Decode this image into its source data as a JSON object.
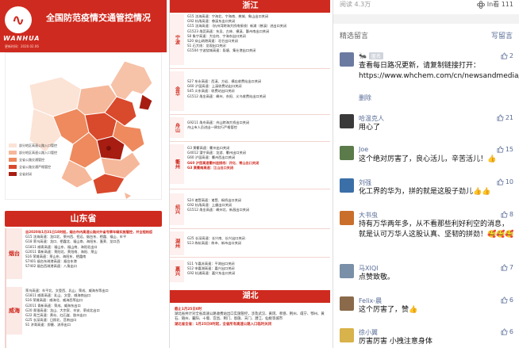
{
  "panel1": {
    "brand": "WANHUA",
    "title": "全国防范疫情交通管控情况",
    "date": "更新时间：2020.02.06",
    "legend": [
      {
        "label": "部分地区高速公路入口管控",
        "color": "#fbe3d6"
      },
      {
        "label": "部分地区高速公路入口管控",
        "color": "#f6b89a"
      },
      {
        "label": "全省公路交通管控",
        "color": "#ee8a5e"
      },
      {
        "label": "全省公路交通严格管控",
        "color": "#d9492c"
      },
      {
        "label": "全省封闭",
        "color": "#a71d12"
      }
    ],
    "province": "山东省",
    "city_yantai": "烟台",
    "city_weihai": "威海",
    "lines_a": [
      "自2020年1月31日18时起，烟台市内高速公路对外省号牌车辆实施管控，并全程检疫",
      "G15 沈海高速：龙口北、莱州西、招远、烟台东、栖霞、福山、牟平",
      "G18 荣乌高速：龙口、栖霞北、福山南、海阳东、蓬莱、龙口西",
      "G1811 威青高速：福山东、福山南、海阳北出口",
      "G2011 青新高速：莱阳北、莱阳南、海阳、莱山",
      "S16 荣潍高速：莱山东、海阳东、栖霞南",
      "S7401 烟台东疏港高速：烟台东港",
      "S7402 烟台西疏港高速：八角出口"
    ],
    "lines_b": [
      "荣乌高速：牟平北、文登西、乳山、荣成、威海东等出口",
      "G1811 威青高速：乳山、文登、威海南出口",
      "S16 荣潍高速：威海北、威海西等出口",
      "G2011 青新高速：荣成、威海东出口",
      "G20 青银高速：龙山、大宗家、辛安、荣成北出口",
      "G22 青兰高速：黄岛、红石崖、胶州出口",
      "G25 长深高速：日照北、莒南出口",
      "S1 济青高速：即墨、流亭出口"
    ]
  },
  "panel2": {
    "zhejiang": "浙江",
    "hubei": "湖北",
    "cities": [
      "宁波",
      "金华",
      "舟山",
      "衢州",
      "绍兴",
      "湖州",
      "嘉兴"
    ],
    "lines_ningbo": [
      "G15 沈海高速：宁海北、宁海南、慈城、象山出口关闭",
      "G92 杭甬高速：慈溪东出口关闭",
      "G15 沈海高速：（杭州湾跨海大桥南接线）新浦（慈溪）进出口关闭",
      "G1523 甬莞高速：东吴、古林、横溪、鄞州南出口关闭",
      "S0 象宁高速：大佳何、宁海东出口关闭",
      "S20 穿山疏港高速：北仑出口关闭",
      "S1 石大线：龙观出口关闭",
      "G1504 宁波绕城高速：段塘、集仕港出口关闭"
    ],
    "lines_jinhua": [
      "S27 东永高速：西溪、方岩、横店收费站出口关闭",
      "G60 沪昆高速：上溪收费站出口关闭",
      "S45 义东高速：收费站出口关闭",
      "G1512 甬金高速：嵊州、东阳、义乌收费站出口关闭"
    ],
    "lines_zhoushan": [
      "G9211 甬舟高速：舟山跨海大桥出口关闭",
      "舟山市人员进出一律实行严格管控"
    ],
    "lines_quzhou": [
      "G3 黄衢高速：衢州出口关闭",
      "G4012 溧宁高速：龙游、衢州出口关闭",
      "G60 沪昆高速：衢州西出口关闭",
      "G60 沪昆高速衢州连接线：开化、常山出口关闭",
      "G3 黄衢南高速：江山出口关闭"
    ],
    "lines_shaoxing": [
      "S24 诸暨高速：诸暨、枫桥出口关闭",
      "G92 杭甬高速：上虞出口关闭",
      "G1512 甬金高速：嵊州北、新昌出口关闭"
    ],
    "lines_huzhou": [
      "G25 长深高速：长兴南、长兴出口关闭",
      "S13 练杭高速：练市、新市出口关闭"
    ],
    "lines_jiaxing": [
      "S11 乍嘉苏高速：平湖出口关闭",
      "S12 申嘉湖高速：嘉兴出口关闭",
      "G92 杭浦高速：嘉兴东出口关闭"
    ],
    "hubei_lines": [
      "截止1月25日0时",
      "湖北省共计对全省高速公路收费站出口实施管控，涉及武汉、黄冈、孝感、荆州、咸宁、鄂州、黄石、随州、襄阳、十堰、宜昌、荆门、恩施、天门、潜江、仙桃等城市",
      "湖北省全省：1月25日0时起，全省所有高速公路入口临时关闭"
    ]
  },
  "panel3": {
    "read_count": "阅读 4.3万",
    "in_look_label": "In看",
    "in_look_count": "111",
    "section_title": "精选留言",
    "write_comment": "写留言",
    "comments": [
      {
        "name": "",
        "masked": "匿名",
        "text": "查看每日路况更新，请复制链接打开：https://www.whchem.com/cn/newsandmedia/news/2244.shtml",
        "likes": "2",
        "extra": "删除",
        "avatar": "#6b7aa0"
      },
      {
        "name": "哈温克人",
        "text": "用心了",
        "likes": "21",
        "avatar": "#3a3a3a"
      },
      {
        "name": "Joe",
        "text": "这个绝对厉害了，良心活儿，辛苦活儿！👍",
        "likes": "15",
        "avatar": "#5b7b4a"
      },
      {
        "name": "刘强",
        "text": "化工界的华为，拼的就是这股子劲儿👍👍",
        "likes": "10",
        "avatar": "#3b6fa8"
      },
      {
        "name": "大书虫",
        "text": "持有万华两年多，从不看那些利好利空的消息，就是认可万华人这股认真、坚韧的拼劲！🥰🥰🥰",
        "likes": "8",
        "avatar": "#c96f2b"
      },
      {
        "name": "马XIQI",
        "text": "点赞致敬。",
        "likes": "7",
        "avatar": "#7a8fa8"
      },
      {
        "name": "Felix-晨",
        "text": "这个厉害了，赞👍",
        "likes": "6",
        "avatar": "#8a6a4a"
      },
      {
        "name": "徐小翼",
        "text": "厉害厉害 小拽注意身体",
        "likes": "6",
        "avatar": "#d8b24a"
      }
    ]
  }
}
